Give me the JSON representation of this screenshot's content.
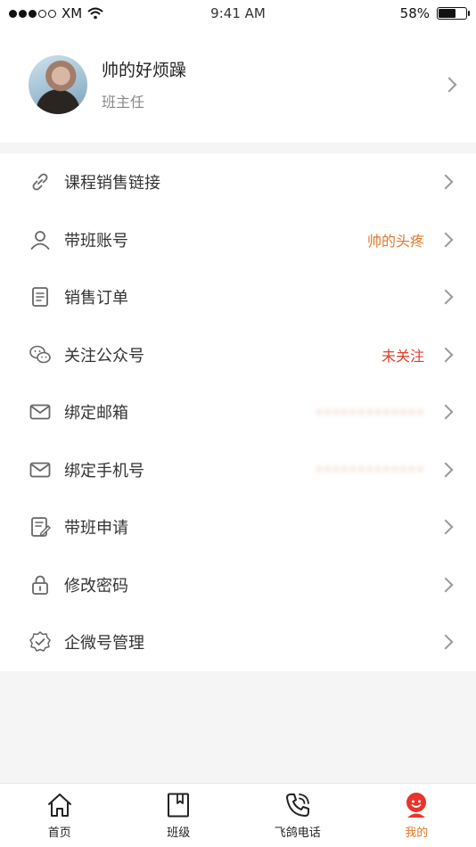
{
  "status_bar": {
    "carrier": "XM",
    "time": "9:41 AM",
    "battery_text": "58%",
    "battery_level": 0.58
  },
  "profile": {
    "name": "帅的好烦躁",
    "role": "班主任"
  },
  "menu": [
    {
      "label": "课程销售链接",
      "icon": "link-icon",
      "value": ""
    },
    {
      "label": "带班账号",
      "icon": "user-icon",
      "value": "帅的头疼",
      "value_color": "#e2792a"
    },
    {
      "label": "销售订单",
      "icon": "document-icon",
      "value": ""
    },
    {
      "label": "关注公众号",
      "icon": "wechat-icon",
      "value": "未关注",
      "value_color": "#e03c2c"
    },
    {
      "label": "绑定邮箱",
      "icon": "mail-icon",
      "value": "",
      "value_blurred": true
    },
    {
      "label": "绑定手机号",
      "icon": "mail-icon",
      "value": "",
      "value_blurred": true
    },
    {
      "label": "带班申请",
      "icon": "edit-document-icon",
      "value": ""
    },
    {
      "label": "修改密码",
      "icon": "lock-icon",
      "value": ""
    },
    {
      "label": "企微号管理",
      "icon": "badge-check-icon",
      "value": ""
    }
  ],
  "tabs": [
    {
      "label": "首页",
      "icon": "home-icon",
      "active": false
    },
    {
      "label": "班级",
      "icon": "bookmark-book-icon",
      "active": false
    },
    {
      "label": "飞鸽电话",
      "icon": "phone-icon",
      "active": false
    },
    {
      "label": "我的",
      "icon": "profile-avatar-icon",
      "active": true
    }
  ],
  "colors": {
    "accent": "#e2792a",
    "warning": "#e03c2c",
    "background": "#f5f5f5"
  }
}
